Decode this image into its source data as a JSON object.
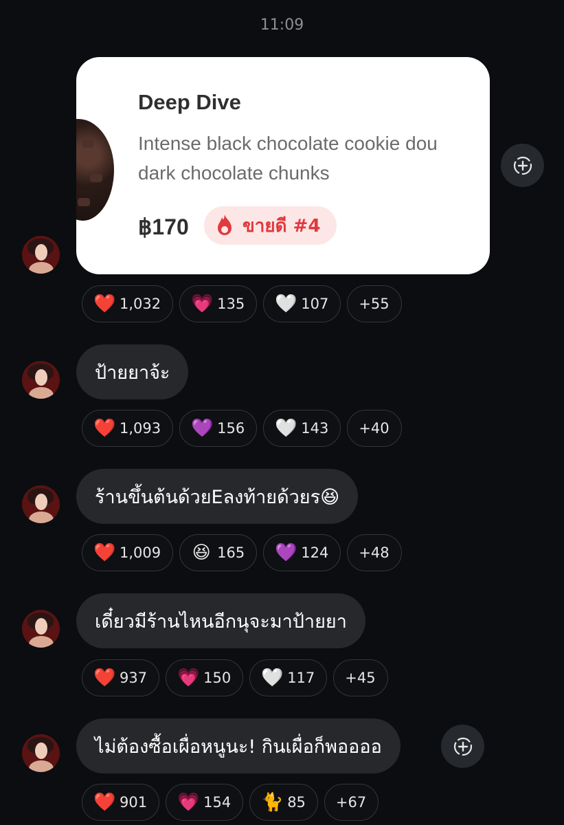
{
  "timestamp": "11:09",
  "card": {
    "title": "Deep Dive",
    "description": "Intense black chocolate cookie dough dark chocolate chunks",
    "desc_line1": "Intense black chocolate cookie dou",
    "desc_line2": "dark chocolate chunks",
    "price": "฿170",
    "badge": "ขายดี #4"
  },
  "messages": [
    {
      "text": "",
      "reactions": [
        {
          "emoji": "❤️",
          "count": "1,032"
        },
        {
          "emoji": "💗",
          "count": "135"
        },
        {
          "emoji": "🤍",
          "count": "107"
        },
        {
          "emoji": "",
          "count": "+55"
        }
      ]
    },
    {
      "text": "ป้ายยาจ้ะ",
      "reactions": [
        {
          "emoji": "❤️",
          "count": "1,093"
        },
        {
          "emoji": "💜",
          "count": "156"
        },
        {
          "emoji": "🤍",
          "count": "143"
        },
        {
          "emoji": "",
          "count": "+40"
        }
      ]
    },
    {
      "text": "ร้านขึ้นต้นด้วยEลงท้ายด้วยร😆",
      "reactions": [
        {
          "emoji": "❤️",
          "count": "1,009"
        },
        {
          "emoji": "😆",
          "count": "165"
        },
        {
          "emoji": "💜",
          "count": "124"
        },
        {
          "emoji": "",
          "count": "+48"
        }
      ]
    },
    {
      "text": "เดี๋ยวมีร้านไหนอีกนุจะมาป้ายยา",
      "reactions": [
        {
          "emoji": "❤️",
          "count": "937"
        },
        {
          "emoji": "💗",
          "count": "150"
        },
        {
          "emoji": "🤍",
          "count": "117"
        },
        {
          "emoji": "",
          "count": "+45"
        }
      ]
    },
    {
      "text": "ไม่ต้องซื้อเผื่อหนูนะ! กินเผื่อก็พออออ",
      "reactions": [
        {
          "emoji": "❤️",
          "count": "901"
        },
        {
          "emoji": "💗",
          "count": "154"
        },
        {
          "emoji": "🐈",
          "count": "85"
        },
        {
          "emoji": "",
          "count": "+67"
        }
      ]
    }
  ],
  "icons": {
    "add_reaction": "add-reaction-icon",
    "fire": "fire-icon"
  },
  "colors": {
    "background": "#0b0d10",
    "bubble": "#26282c",
    "badge_bg": "#fde6e6",
    "badge_text": "#e0393e"
  }
}
